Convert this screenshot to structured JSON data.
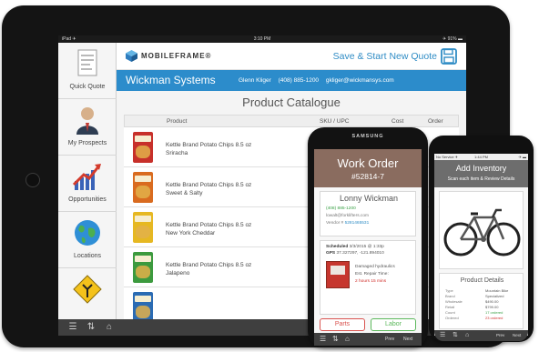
{
  "ipad": {
    "status": {
      "left": "iPad ✈",
      "time": "3:10 PM",
      "right": "✈ 91% ▬"
    },
    "sidebar": {
      "items": [
        {
          "label": "Quick Quote",
          "icon": "document-icon"
        },
        {
          "label": "My Prospects",
          "icon": "person-icon"
        },
        {
          "label": "Opportunities",
          "icon": "growth-chart-icon"
        },
        {
          "label": "Locations",
          "icon": "globe-icon"
        },
        {
          "label": "",
          "icon": "road-sign-icon"
        }
      ]
    },
    "header": {
      "logo": "MOBILEFRAME®",
      "save_label": "Save & Start New Quote",
      "save_icon": "floppy-disk-icon"
    },
    "customer": {
      "company": "Wickman Systems",
      "name": "Glenn Kliger",
      "phone": "(408) 885-1200",
      "email": "gkliger@wickmansys.com"
    },
    "catalogue": {
      "title": "Product Catalogue",
      "columns": [
        "Product",
        "SKU / UPC",
        "Cost",
        "Order"
      ],
      "rows": [
        {
          "name_line1": "Kettle Brand Potato Chips 8.5 oz",
          "name_line2": "Sriracha",
          "color": "#c7302a",
          "brand": "Kettle"
        },
        {
          "name_line1": "Kettle Brand Potato Chips 8.5 oz",
          "name_line2": "Sweet & Salty",
          "color": "#d96b1f",
          "brand": "Kettle"
        },
        {
          "name_line1": "Kettle Brand Potato Chips 8.5 oz",
          "name_line2": "New York Cheddar",
          "color": "#e6b822",
          "brand": "Kettle"
        },
        {
          "name_line1": "Kettle Brand Potato Chips 8.5 oz",
          "name_line2": "Jalapeno",
          "color": "#3c9a3e",
          "brand": "Kettle"
        },
        {
          "name_line1": "",
          "name_line2": "",
          "color": "#2b6bb3",
          "brand": "Kettle"
        }
      ]
    },
    "bottom_bar": {
      "icons": [
        "list-icon",
        "sort-icon",
        "home-icon"
      ]
    }
  },
  "samsung": {
    "brand": "SAMSUNG",
    "work_order": {
      "title": "Work Order",
      "number": "#52814-7"
    },
    "customer": {
      "name": "Lonny Wickman",
      "phone": "(408) 885-1200",
      "email": "lowalt@forklifters.com",
      "vendor_label": "Vendor #",
      "vendor_value": "5281465531"
    },
    "schedule": {
      "scheduled_label": "Scheduled",
      "scheduled_value": "3/3/2015 @ 1:33p",
      "gps_label": "GPS",
      "gps_value": "37.327297, -121.894010",
      "issue": "Damaged hydraulics",
      "est_label": "Est. Repair Time:",
      "repair_time": "2 hours 15 mins"
    },
    "buttons": {
      "parts": "Parts",
      "labor": "Labor"
    },
    "nav": {
      "prev": "Prev",
      "next": "Next"
    }
  },
  "iphone": {
    "status": {
      "left": "No Service ✈",
      "time": "1:44 PM",
      "right": "✈ ▬"
    },
    "header": {
      "title": "Add Inventory",
      "subtitle": "Scan each item & Review Details"
    },
    "product_details": {
      "title": "Product Details",
      "rows": [
        {
          "label": "Type",
          "value": "Mountain Bike",
          "tone": ""
        },
        {
          "label": "Brand",
          "value": "Specialized",
          "tone": ""
        },
        {
          "label": "Wholesale",
          "value": "$490.00",
          "tone": ""
        },
        {
          "label": "Retail",
          "value": "$799.00",
          "tone": ""
        },
        {
          "label": "Count",
          "value": "17 ordered",
          "tone": "green"
        },
        {
          "label": "Ordered",
          "value": "23 ordered",
          "tone": "red"
        }
      ]
    },
    "nav": {
      "prev": "Prev",
      "next": "Next"
    }
  }
}
